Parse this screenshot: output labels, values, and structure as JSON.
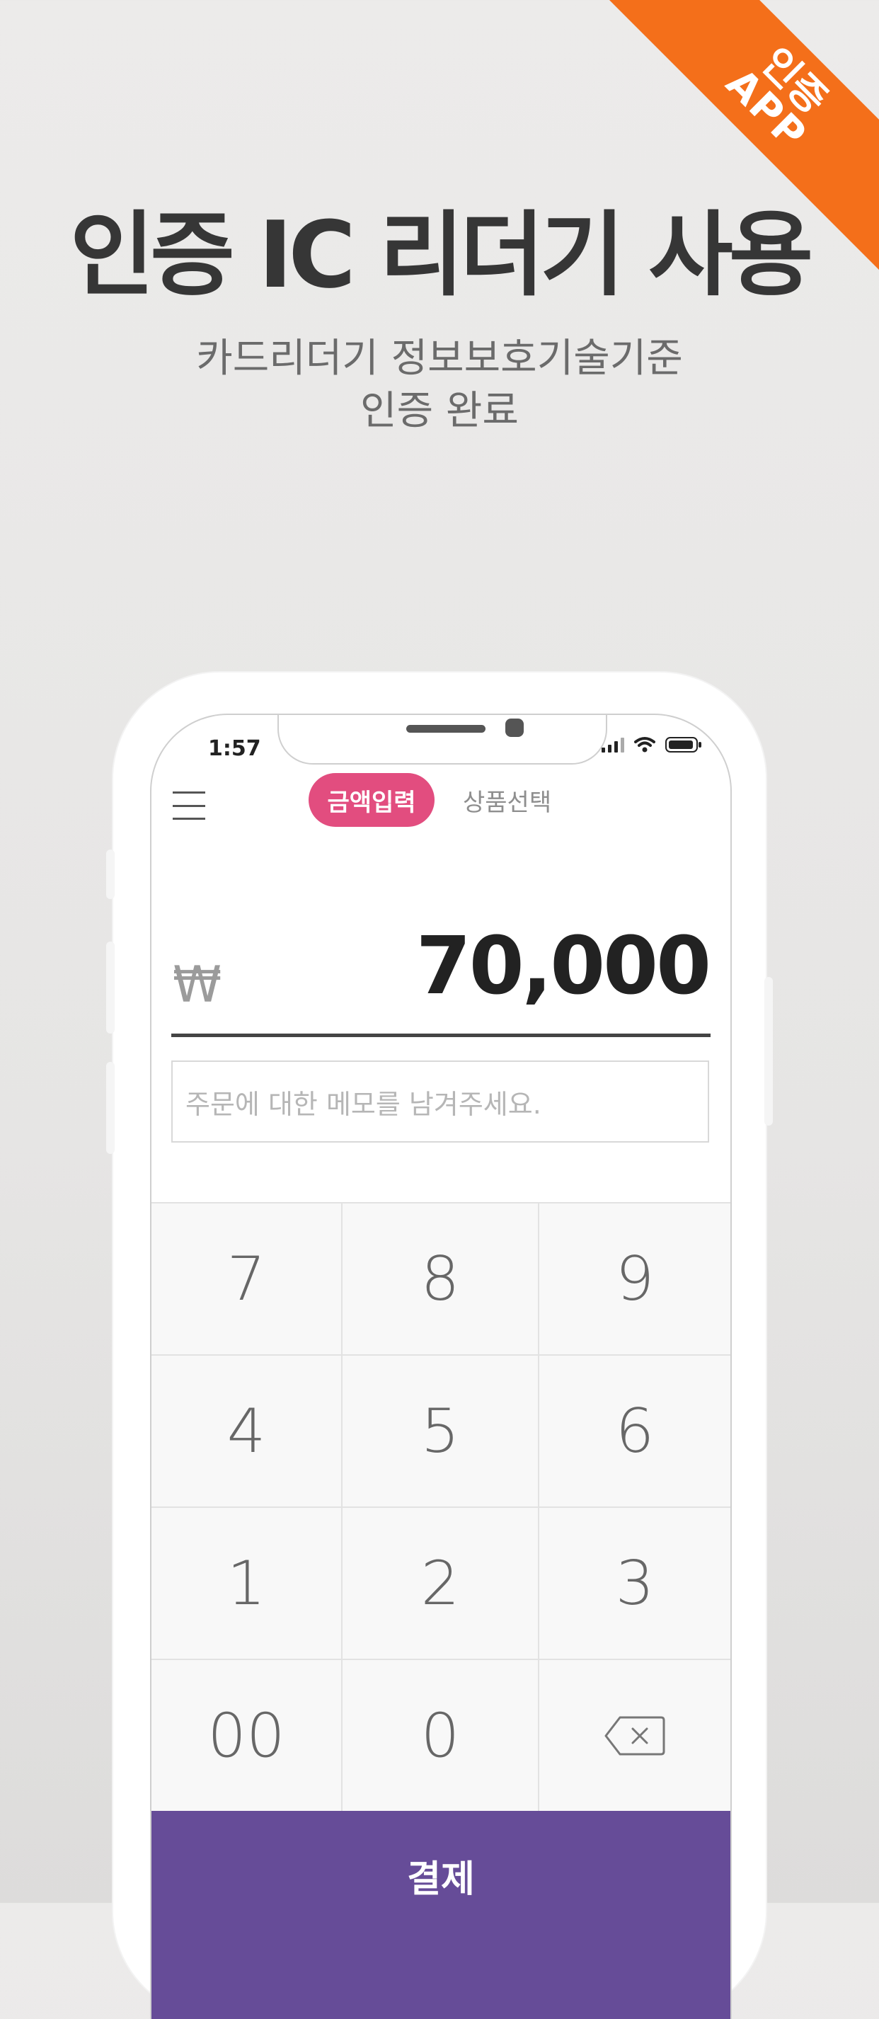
{
  "ribbon": {
    "line1": "인증",
    "line2": "APP",
    "color": "#f46f1a"
  },
  "headline": "인증 IC 리더기 사용",
  "subtitle": {
    "line1": "카드리더기 정보보호기술기준",
    "line2": "인증 완료"
  },
  "phone": {
    "status": {
      "time": "1:57",
      "icons": [
        "signal-icon",
        "wifi-icon",
        "battery-icon"
      ]
    },
    "tabs": [
      {
        "label": "금액입력",
        "active": true
      },
      {
        "label": "상품선택",
        "active": false
      }
    ],
    "currency_symbol": "₩",
    "amount": "70,000",
    "memo_placeholder": "주문에 대한 메모를 남겨주세요.",
    "keypad": {
      "rows": [
        [
          "7",
          "8",
          "9"
        ],
        [
          "4",
          "5",
          "6"
        ],
        [
          "1",
          "2",
          "3"
        ],
        [
          "00",
          "0",
          "backspace-icon"
        ]
      ]
    },
    "pay_button": "결제",
    "colors": {
      "tab_active": "#e24d7f",
      "pay_button": "#664c98"
    }
  }
}
